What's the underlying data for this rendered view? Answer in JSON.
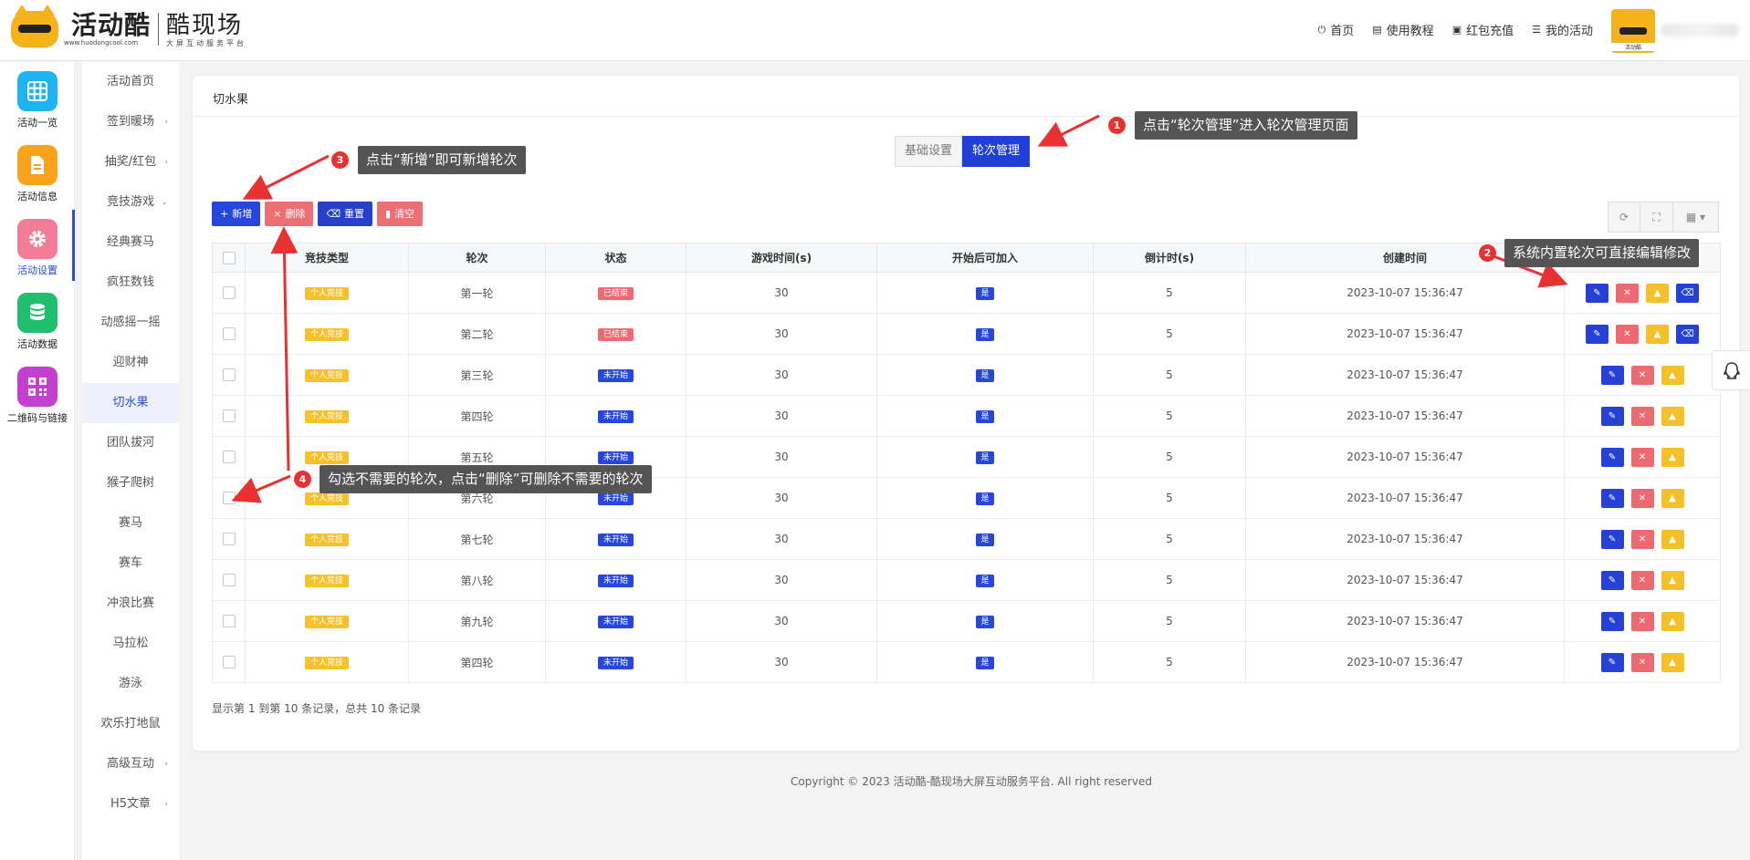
{
  "header": {
    "logo_main": "活动酷",
    "logo_url": "www.huodongcool.com",
    "logo_secondary": "酷现场",
    "logo_tagline": "大屏互动服务平台",
    "nav": [
      {
        "label": "首页",
        "icon": "home-icon"
      },
      {
        "label": "使用教程",
        "icon": "book-icon"
      },
      {
        "label": "红包充值",
        "icon": "wallet-icon"
      },
      {
        "label": "我的活动",
        "icon": "list-icon"
      }
    ],
    "avatar_label": "活动酷"
  },
  "iconbar": [
    {
      "label": "活动一览",
      "color": "#1db4f0",
      "icon": "grid-icon"
    },
    {
      "label": "活动信息",
      "color": "#f9a31d",
      "icon": "document-icon"
    },
    {
      "label": "活动设置",
      "color": "#f37c96",
      "icon": "gear-icon",
      "active": true
    },
    {
      "label": "活动数据",
      "color": "#1fbf6e",
      "icon": "database-icon"
    },
    {
      "label": "二维码与链接",
      "color": "#c43fcf",
      "icon": "qrcode-icon"
    }
  ],
  "submenu": [
    {
      "label": "活动首页"
    },
    {
      "label": "签到暖场",
      "chevron": "›"
    },
    {
      "label": "抽奖/红包",
      "chevron": "›"
    },
    {
      "label": "竞技游戏",
      "chevron": "⌄"
    },
    {
      "label": "经典赛马"
    },
    {
      "label": "疯狂数钱"
    },
    {
      "label": "动感摇一摇"
    },
    {
      "label": "迎财神"
    },
    {
      "label": "切水果",
      "active": true
    },
    {
      "label": "团队拔河"
    },
    {
      "label": "猴子爬树"
    },
    {
      "label": "赛马"
    },
    {
      "label": "赛车"
    },
    {
      "label": "冲浪比赛"
    },
    {
      "label": "马拉松"
    },
    {
      "label": "游泳"
    },
    {
      "label": "欢乐打地鼠"
    },
    {
      "label": "高级互动",
      "chevron": "›"
    },
    {
      "label": "H5文章",
      "chevron": "›"
    }
  ],
  "panel": {
    "title": "切水果",
    "tabs": [
      {
        "label": "基础设置",
        "active": false
      },
      {
        "label": "轮次管理",
        "active": true
      }
    ],
    "toolbar": {
      "add": "新增",
      "delete": "删除",
      "reset": "重置",
      "clear": "清空"
    },
    "columns": [
      "竞技类型",
      "轮次",
      "状态",
      "游戏时间(s)",
      "开始后可加入",
      "倒计时(s)",
      "创建时间"
    ],
    "rows": [
      {
        "type": "个人竞技",
        "round": "第一轮",
        "status": "已结束",
        "status_kind": "red",
        "time": "30",
        "join": "是",
        "countdown": "5",
        "created": "2023-10-07 15:36:47",
        "has_reset": true
      },
      {
        "type": "个人竞技",
        "round": "第二轮",
        "status": "已结束",
        "status_kind": "red",
        "time": "30",
        "join": "是",
        "countdown": "5",
        "created": "2023-10-07 15:36:47",
        "has_reset": true
      },
      {
        "type": "个人竞技",
        "round": "第三轮",
        "status": "未开始",
        "status_kind": "blue",
        "time": "30",
        "join": "是",
        "countdown": "5",
        "created": "2023-10-07 15:36:47",
        "has_reset": false
      },
      {
        "type": "个人竞技",
        "round": "第四轮",
        "status": "未开始",
        "status_kind": "blue",
        "time": "30",
        "join": "是",
        "countdown": "5",
        "created": "2023-10-07 15:36:47",
        "has_reset": false
      },
      {
        "type": "个人竞技",
        "round": "第五轮",
        "status": "未开始",
        "status_kind": "blue",
        "time": "30",
        "join": "是",
        "countdown": "5",
        "created": "2023-10-07 15:36:47",
        "has_reset": false
      },
      {
        "type": "个人竞技",
        "round": "第六轮",
        "status": "未开始",
        "status_kind": "blue",
        "time": "30",
        "join": "是",
        "countdown": "5",
        "created": "2023-10-07 15:36:47",
        "has_reset": false
      },
      {
        "type": "个人竞技",
        "round": "第七轮",
        "status": "未开始",
        "status_kind": "blue",
        "time": "30",
        "join": "是",
        "countdown": "5",
        "created": "2023-10-07 15:36:47",
        "has_reset": false
      },
      {
        "type": "个人竞技",
        "round": "第八轮",
        "status": "未开始",
        "status_kind": "blue",
        "time": "30",
        "join": "是",
        "countdown": "5",
        "created": "2023-10-07 15:36:47",
        "has_reset": false
      },
      {
        "type": "个人竞技",
        "round": "第九轮",
        "status": "未开始",
        "status_kind": "blue",
        "time": "30",
        "join": "是",
        "countdown": "5",
        "created": "2023-10-07 15:36:47",
        "has_reset": false
      },
      {
        "type": "个人竞技",
        "round": "第四轮",
        "status": "未开始",
        "status_kind": "blue",
        "time": "30",
        "join": "是",
        "countdown": "5",
        "created": "2023-10-07 15:36:47",
        "has_reset": false
      }
    ],
    "pagination_info": "显示第 1 到第 10 条记录，总共 10 条记录"
  },
  "annotations": [
    {
      "number": "1",
      "text": "点击“轮次管理”进入轮次管理页面"
    },
    {
      "number": "2",
      "text": "系统内置轮次可直接编辑修改"
    },
    {
      "number": "3",
      "text": "点击“新增”即可新增轮次"
    },
    {
      "number": "4",
      "text": "勾选不需要的轮次，点击“删除”可删除不需要的轮次"
    }
  ],
  "copyright": "Copyright © 2023 活动酷-酷现场大屏互动服务平台. All right reserved",
  "colors": {
    "primary": "#2646e0",
    "danger": "#ee6a73",
    "warning": "#f6c12a",
    "annotation": "#545454"
  }
}
